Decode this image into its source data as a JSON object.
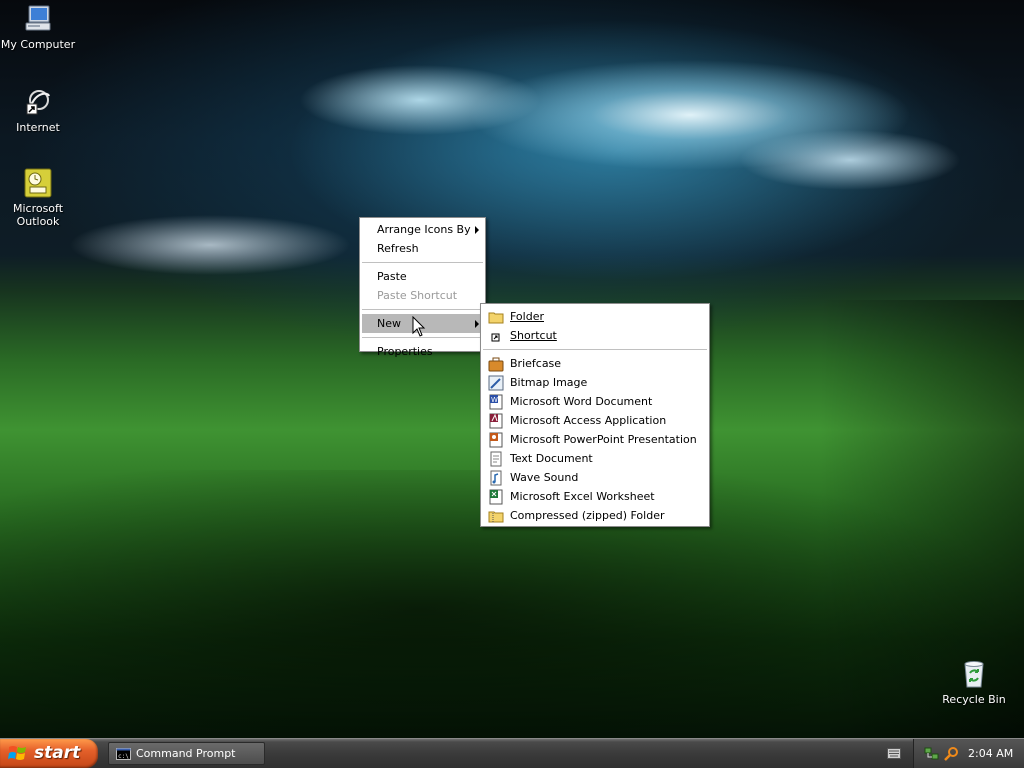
{
  "desktop": {
    "icons": [
      {
        "label": "My Computer",
        "icon": "my-computer-icon"
      },
      {
        "label": "Internet",
        "icon": "internet-explorer-shortcut-icon"
      },
      {
        "label": "Microsoft\nOutlook",
        "icon": "outlook-icon"
      },
      {
        "label": "Recycle Bin",
        "icon": "recycle-bin-icon"
      }
    ]
  },
  "context_menu": {
    "items": [
      {
        "label": "Arrange Icons By",
        "has_submenu": true
      },
      {
        "label": "Refresh"
      },
      {
        "label": "Paste"
      },
      {
        "label": "Paste Shortcut",
        "disabled": true
      },
      {
        "label": "New",
        "has_submenu": true,
        "selected": true
      },
      {
        "label": "Properties"
      }
    ]
  },
  "new_submenu": {
    "items": [
      {
        "label": "Folder",
        "icon": "folder-icon"
      },
      {
        "label": "Shortcut",
        "icon": "shortcut-icon"
      },
      {
        "label": "Briefcase",
        "icon": "briefcase-icon"
      },
      {
        "label": "Bitmap Image",
        "icon": "bitmap-image-icon"
      },
      {
        "label": "Microsoft Word Document",
        "icon": "word-document-icon"
      },
      {
        "label": "Microsoft Access Application",
        "icon": "access-application-icon"
      },
      {
        "label": "Microsoft PowerPoint Presentation",
        "icon": "powerpoint-presentation-icon"
      },
      {
        "label": "Text Document",
        "icon": "text-document-icon"
      },
      {
        "label": "Wave Sound",
        "icon": "wave-sound-icon"
      },
      {
        "label": "Microsoft Excel Worksheet",
        "icon": "excel-worksheet-icon"
      },
      {
        "label": "Compressed (zipped) Folder",
        "icon": "zipped-folder-icon"
      }
    ]
  },
  "taskbar": {
    "start_label": "start",
    "tasks": [
      {
        "label": "Command Prompt",
        "icon": "command-prompt-icon"
      }
    ],
    "clock": "2:04 AM"
  },
  "colors": {
    "start_button": "#e4602a",
    "taskbar": "#3a3a3a",
    "menu_highlight": "#b8b8b8"
  }
}
